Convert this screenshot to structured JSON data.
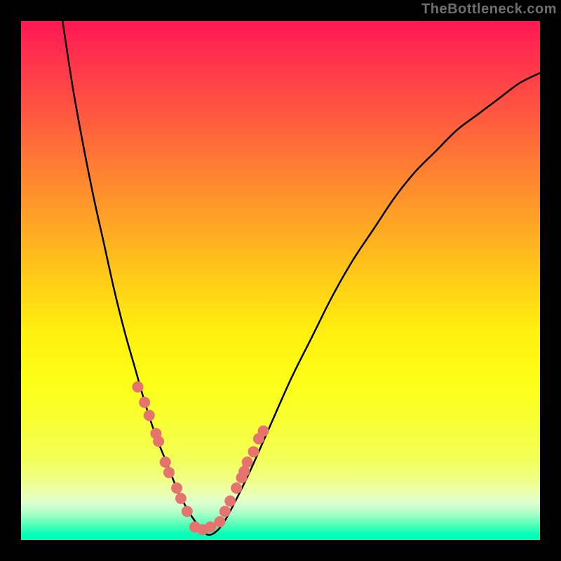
{
  "attribution": "TheBottleneck.com",
  "colors": {
    "salmon_dot": "#e4746d",
    "curve": "#000000"
  },
  "chart_data": {
    "type": "line",
    "title": "",
    "xlabel": "",
    "ylabel": "",
    "xlim": [
      0,
      100
    ],
    "ylim": [
      0,
      100
    ],
    "grid": false,
    "legend": false,
    "series": [
      {
        "name": "curve",
        "type": "line",
        "color": "#000000",
        "x": [
          8,
          10,
          12,
          14,
          16,
          18,
          20,
          22,
          24,
          26,
          28,
          30,
          32,
          34,
          36,
          38,
          40,
          44,
          48,
          52,
          56,
          60,
          64,
          68,
          72,
          76,
          80,
          84,
          88,
          92,
          96,
          100
        ],
        "y": [
          100,
          87,
          76,
          66,
          57,
          48,
          40,
          33,
          26,
          20,
          15,
          10,
          6,
          3,
          1,
          2,
          5,
          13,
          22,
          31,
          39,
          47,
          54,
          60,
          66,
          71,
          75,
          79,
          82,
          85,
          88,
          90
        ]
      },
      {
        "name": "dots-left",
        "type": "scatter",
        "color": "#e4746d",
        "x": [
          22.5,
          23.8,
          24.7,
          26.0,
          26.5,
          27.8,
          28.5,
          30.0,
          30.8,
          32.0
        ],
        "y": [
          29.5,
          26.5,
          24.0,
          20.5,
          19.0,
          15.0,
          13.0,
          10.0,
          8.0,
          5.5
        ]
      },
      {
        "name": "dots-bottom",
        "type": "scatter",
        "color": "#e4746d",
        "x": [
          33.5,
          35.0,
          36.5
        ],
        "y": [
          2.5,
          2.0,
          2.5
        ]
      },
      {
        "name": "dots-right",
        "type": "scatter",
        "color": "#e4746d",
        "x": [
          38.3,
          39.3,
          40.3,
          41.5,
          42.5,
          43.0,
          43.6,
          44.8,
          45.8,
          46.7
        ],
        "y": [
          3.5,
          5.5,
          7.5,
          10.0,
          12.0,
          13.2,
          15.0,
          17.0,
          19.5,
          21.0
        ]
      }
    ]
  }
}
